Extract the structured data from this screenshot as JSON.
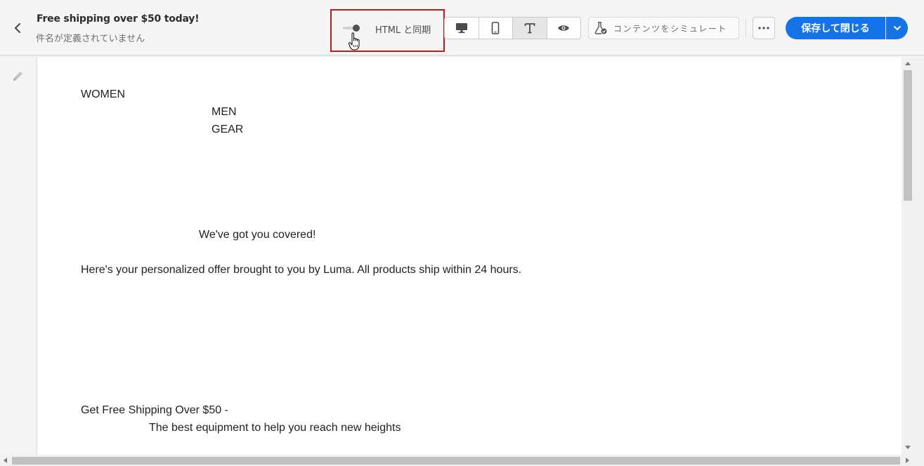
{
  "header": {
    "title": "Free shipping over $50 today!",
    "subtitle": "件名が定義されていません",
    "sync_label": "HTML と同期",
    "sync_toggle_on": true,
    "simulate_label": "コンテンツをシミュレート",
    "save_label": "保存して閉じる",
    "view_modes": [
      {
        "name": "desktop",
        "icon": "desktop-icon",
        "active": false
      },
      {
        "name": "mobile",
        "icon": "mobile-icon",
        "active": false
      },
      {
        "name": "text",
        "icon": "text-icon",
        "active": true
      },
      {
        "name": "preview",
        "icon": "eye-icon",
        "active": false
      }
    ]
  },
  "email": {
    "nav_women": "WOMEN",
    "nav_men": "MEN",
    "nav_gear": "GEAR",
    "heading": "We've got you covered!",
    "intro": "Here's your personalized offer brought to you by Luma. All products ship within 24 hours.",
    "shipping_line": "Get Free Shipping Over $50 -",
    "tagline": "The best equipment to help you reach new heights"
  },
  "colors": {
    "accent": "#1473e6",
    "highlight_border": "#b71c1c",
    "background": "#f5f5f5"
  }
}
